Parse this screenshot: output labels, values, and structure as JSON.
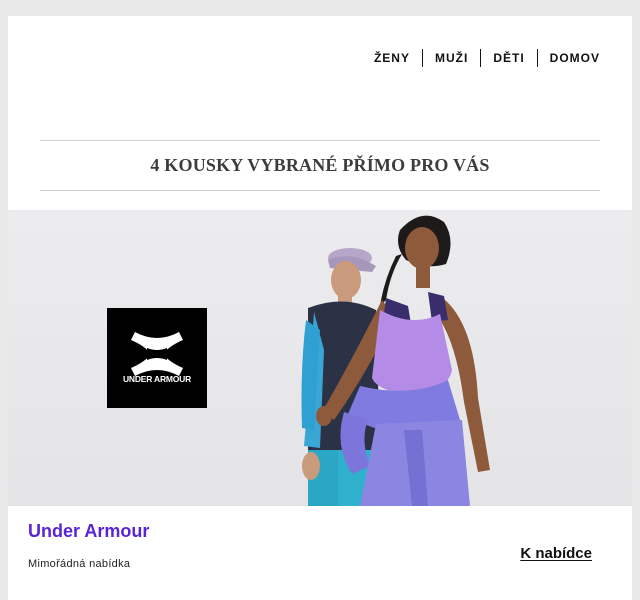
{
  "nav": {
    "items": [
      "ŽENY",
      "MUŽI",
      "DĚTI",
      "DOMOV"
    ]
  },
  "headline": "4 KOUSKY VYBRANÉ PŘÍMO PRO VÁS",
  "hero": {
    "logo_text": "UNDER ARMOUR",
    "colors": {
      "logo_bg": "#000000",
      "background": "#e9e9ec"
    }
  },
  "product": {
    "brand": "Under Armour",
    "offer": "Mimořádná nabídka",
    "cta": "K nabídce"
  },
  "colors": {
    "brand_accent": "#5a24d6",
    "page_bg": "#e9e9e9"
  }
}
